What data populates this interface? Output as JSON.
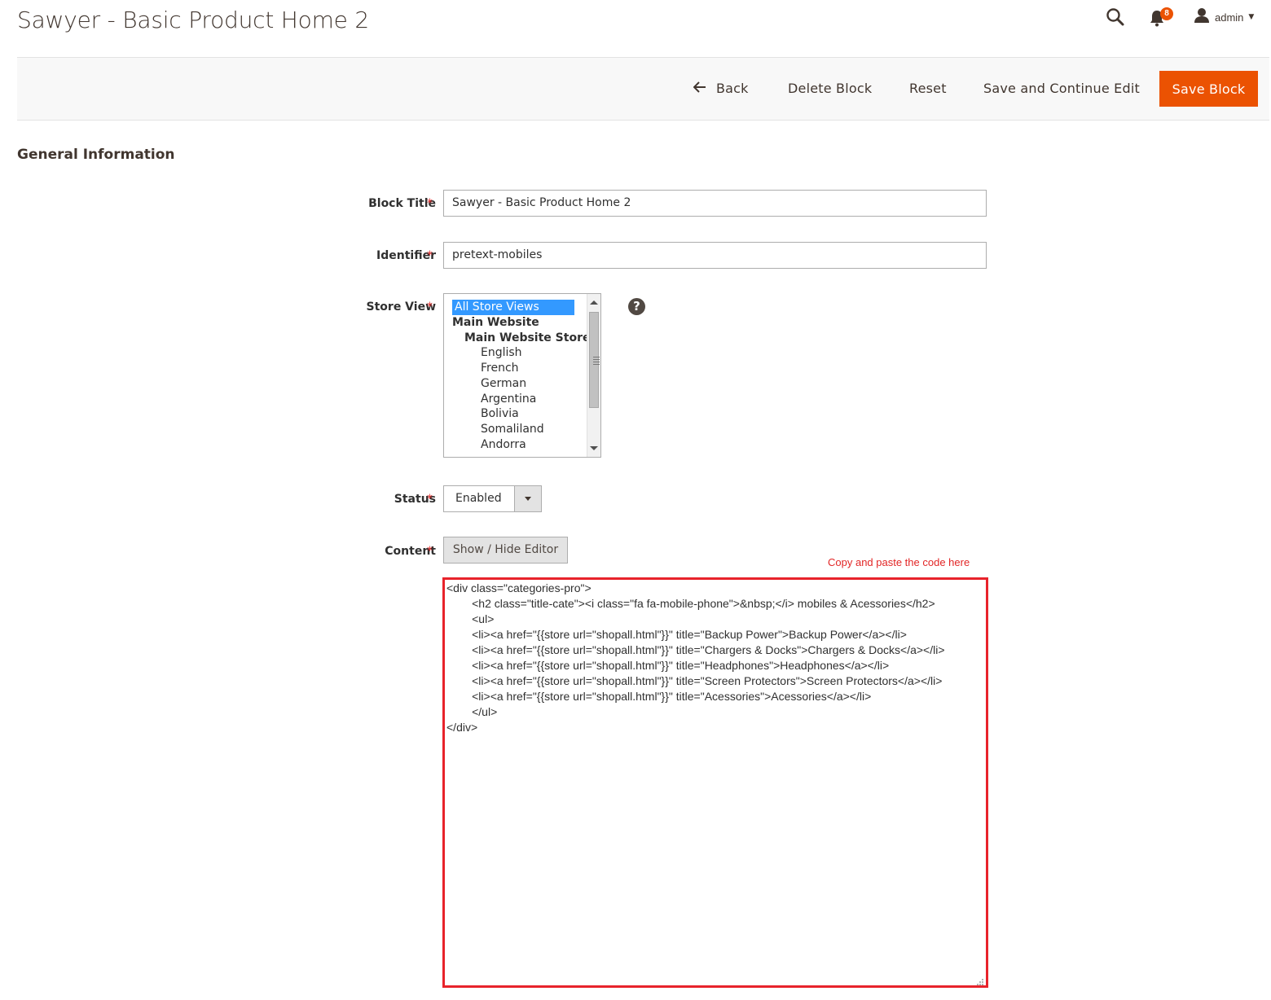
{
  "page": {
    "title": "Sawyer - Basic Product Home 2"
  },
  "header": {
    "notifications_count": "8",
    "user_name": "admin",
    "icons": {
      "search": "search-icon",
      "notifications": "bell-icon",
      "user": "user-icon",
      "caret": "chevron-down-icon"
    }
  },
  "actions": {
    "back": "Back",
    "delete": "Delete Block",
    "reset": "Reset",
    "save_continue": "Save and Continue Edit",
    "save": "Save Block",
    "accent_color": "#eb5202"
  },
  "section": {
    "title": "General Information"
  },
  "form": {
    "block_title": {
      "label": "Block Title",
      "required_mark": "*",
      "value": "Sawyer - Basic Product Home 2"
    },
    "identifier": {
      "label": "Identifier",
      "required_mark": "*",
      "value": "pretext-mobiles"
    },
    "store_view": {
      "label": "Store View",
      "required_mark": "*",
      "options": [
        {
          "label": "All Store Views",
          "selected": true,
          "bold": false,
          "indent": 0
        },
        {
          "label": "Main Website",
          "selected": false,
          "bold": true,
          "indent": 0
        },
        {
          "label": "Main Website Store",
          "selected": false,
          "bold": true,
          "indent": 1
        },
        {
          "label": "English",
          "selected": false,
          "bold": false,
          "indent": 2
        },
        {
          "label": "French",
          "selected": false,
          "bold": false,
          "indent": 2
        },
        {
          "label": "German",
          "selected": false,
          "bold": false,
          "indent": 2
        },
        {
          "label": "Argentina",
          "selected": false,
          "bold": false,
          "indent": 2
        },
        {
          "label": "Bolivia",
          "selected": false,
          "bold": false,
          "indent": 2
        },
        {
          "label": "Somaliland",
          "selected": false,
          "bold": false,
          "indent": 2
        },
        {
          "label": "Andorra",
          "selected": false,
          "bold": false,
          "indent": 2
        }
      ],
      "help": "?"
    },
    "status": {
      "label": "Status",
      "required_mark": "*",
      "value": "Enabled"
    },
    "content": {
      "label": "Content",
      "required_mark": "*",
      "editor_button": "Show / Hide Editor",
      "annotation": "Copy and paste the code here",
      "annotation_color": "#e22626",
      "lines": [
        "<div class=\"categories-pro\">",
        "        <h2 class=\"title-cate\"><i class=\"fa fa-mobile-phone\">&nbsp;</i> mobiles & Acessories</h2>",
        "        <ul>",
        "        <li><a href=\"{{store url=\"shopall.html\"}}\" title=\"Backup Power\">Backup Power</a></li>",
        "        <li><a href=\"{{store url=\"shopall.html\"}}\" title=\"Chargers & Docks\">Chargers & Docks</a></li>",
        "        <li><a href=\"{{store url=\"shopall.html\"}}\" title=\"Headphones\">Headphones</a></li>",
        "        <li><a href=\"{{store url=\"shopall.html\"}}\" title=\"Screen Protectors\">Screen Protectors</a></li>",
        "        <li><a href=\"{{store url=\"shopall.html\"}}\" title=\"Acessories\">Acessories</a></li>",
        "        </ul>",
        "</div>"
      ]
    }
  }
}
